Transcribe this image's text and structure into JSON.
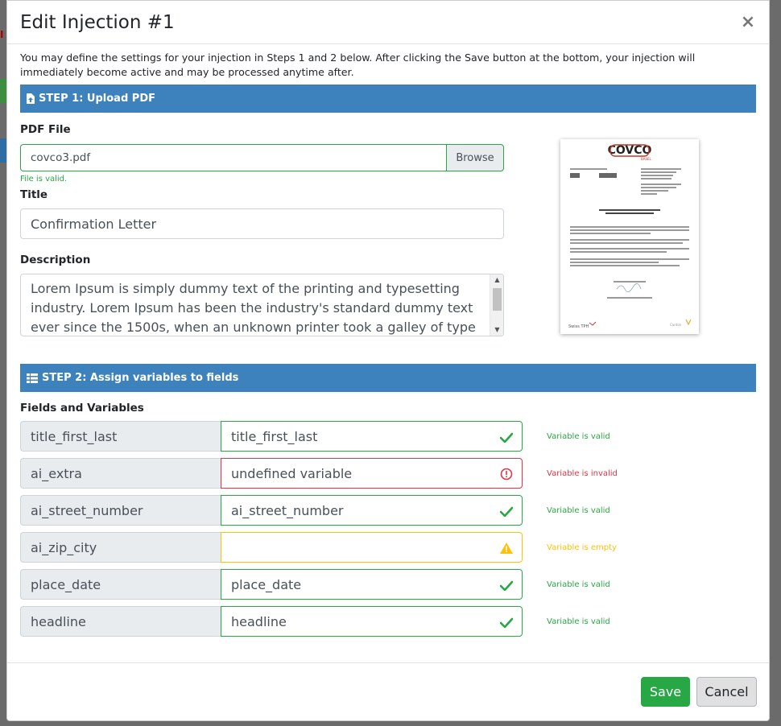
{
  "modal": {
    "title": "Edit Injection #1",
    "close_label": "×",
    "intro": "You may define the settings for your injection in Steps 1 and 2 below. After clicking the Save button at the bottom, your injection will immediately become active and may be processed anytime after."
  },
  "step1": {
    "header": "STEP 1: Upload PDF",
    "pdf_label": "PDF File",
    "file_name": "covco3.pdf",
    "browse_label": "Browse",
    "file_status": "File is valid.",
    "title_label": "Title",
    "title_value": "Confirmation Letter",
    "description_label": "Description",
    "description_value": "Lorem Ipsum is simply dummy text of the printing and typesetting industry. Lorem Ipsum has been the industry's standard dummy text ever since the 1500s, when an unknown printer took a galley of type and"
  },
  "step2": {
    "header": "STEP 2: Assign variables to fields",
    "fields_label": "Fields and Variables",
    "fields": [
      {
        "key": "title_first_last",
        "value": "title_first_last",
        "status": "valid",
        "message": "Variable is valid"
      },
      {
        "key": "ai_extra",
        "value": "undefined variable",
        "status": "invalid",
        "message": "Variable is invalid"
      },
      {
        "key": "ai_street_number",
        "value": "ai_street_number",
        "status": "valid",
        "message": "Variable is valid"
      },
      {
        "key": "ai_zip_city",
        "value": "",
        "status": "empty",
        "message": "Variable is empty"
      },
      {
        "key": "place_date",
        "value": "place_date",
        "status": "valid",
        "message": "Variable is valid"
      },
      {
        "key": "headline",
        "value": "headline",
        "status": "valid",
        "message": "Variable is valid"
      }
    ]
  },
  "footer": {
    "save_label": "Save",
    "cancel_label": "Cancel"
  },
  "colors": {
    "step_bar": "#3d82bd",
    "valid": "#28a745",
    "invalid": "#dc3545",
    "empty": "#ffc107"
  },
  "icons": {
    "step1": "file-upload-icon",
    "step2": "table-icon",
    "valid": "check-icon",
    "invalid": "exclamation-circle-icon",
    "empty": "warning-triangle-icon"
  }
}
